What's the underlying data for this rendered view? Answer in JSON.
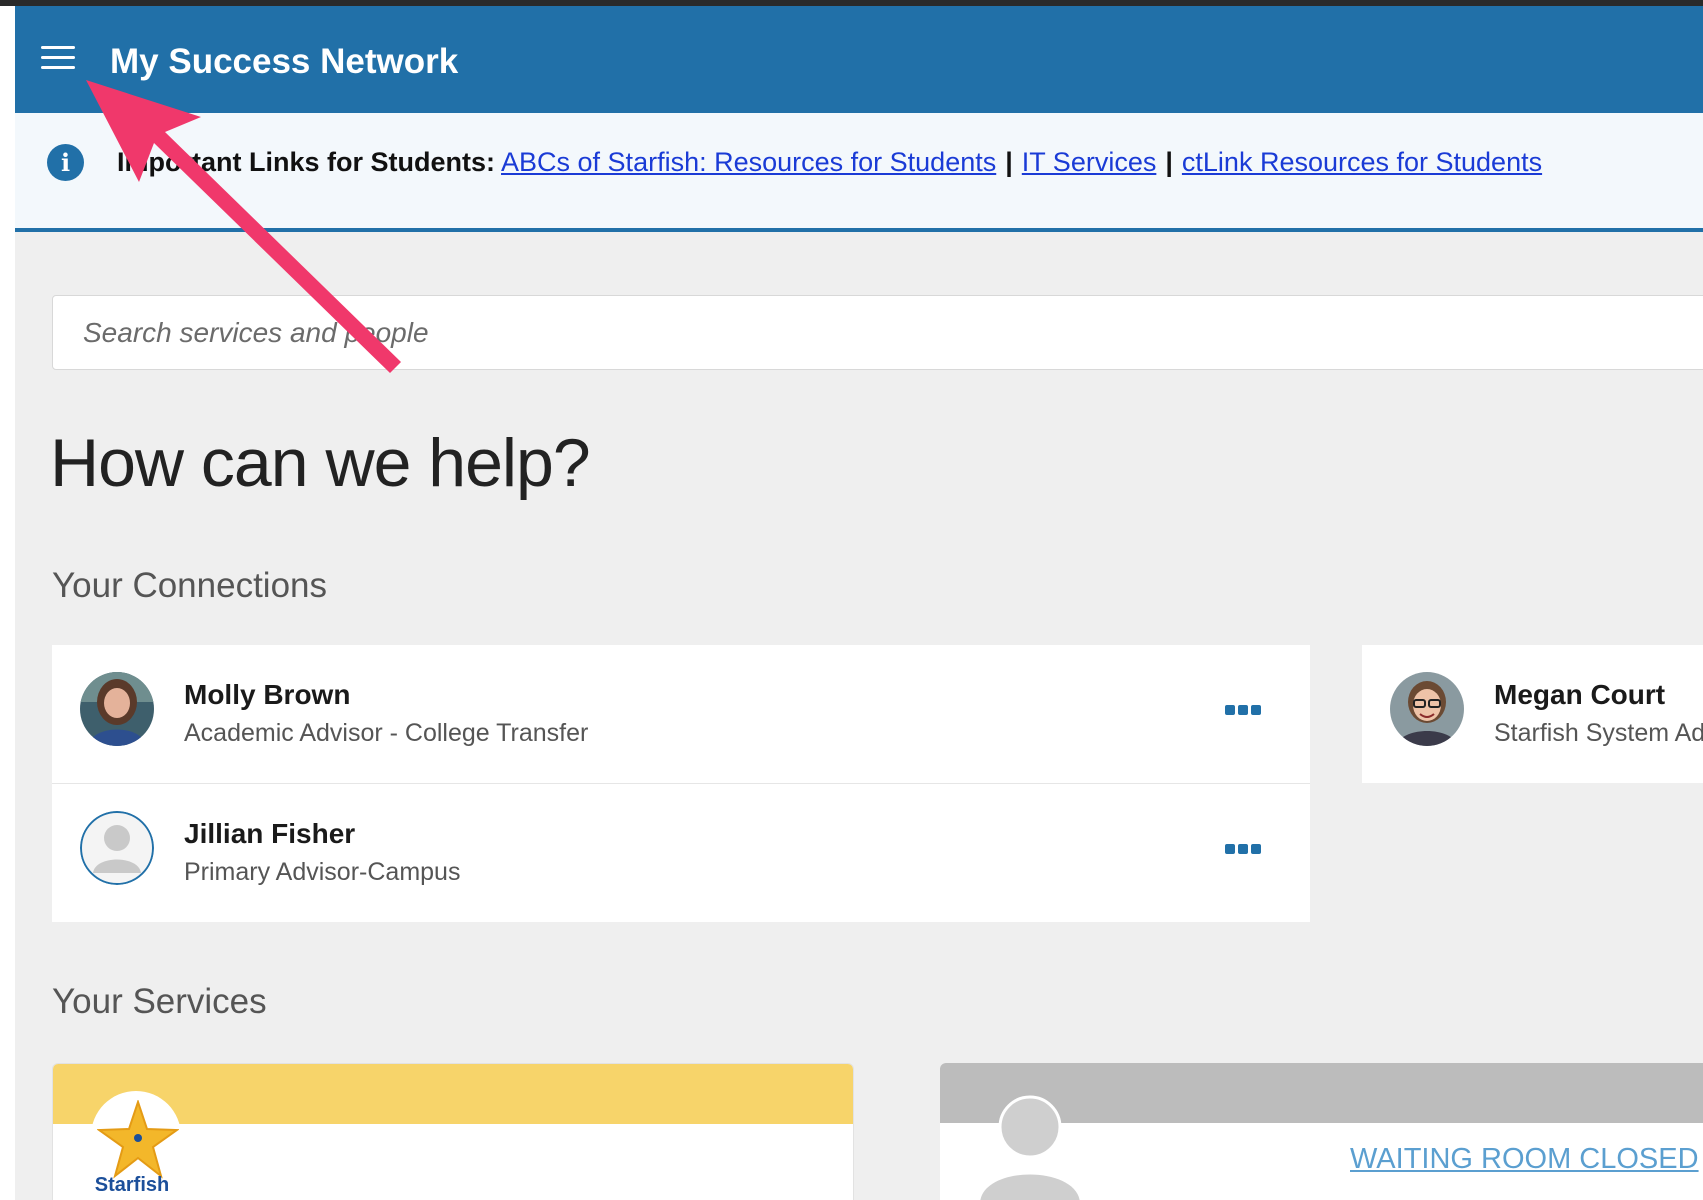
{
  "header": {
    "title": "My Success Network",
    "menu_icon": "hamburger-menu-icon"
  },
  "banner": {
    "icon": "info-icon",
    "prefix": "Important Links for Students:",
    "links": [
      "ABCs of Starfish: Resources for Students",
      "IT Services",
      "ctLink Resources for Students"
    ],
    "separator": "|"
  },
  "search": {
    "placeholder": "Search services and people"
  },
  "hero": {
    "title": "How can we help?"
  },
  "connections": {
    "title": "Your Connections",
    "items": [
      {
        "name": "Molly Brown",
        "role": "Academic Advisor - College Transfer"
      },
      {
        "name": "Jillian Fisher",
        "role": "Primary Advisor-Campus"
      },
      {
        "name": "Megan Court",
        "role": "Starfish System Ad"
      }
    ]
  },
  "services": {
    "title": "Your Services",
    "cards": [
      {
        "logo_text": "Starfish",
        "header_color": "#f7d46a"
      },
      {
        "status": "WAITING ROOM CLOSED",
        "header_color": "#bcbcbc"
      }
    ]
  },
  "colors": {
    "brand_blue": "#2170a8",
    "annotation_arrow": "#f0386b"
  }
}
